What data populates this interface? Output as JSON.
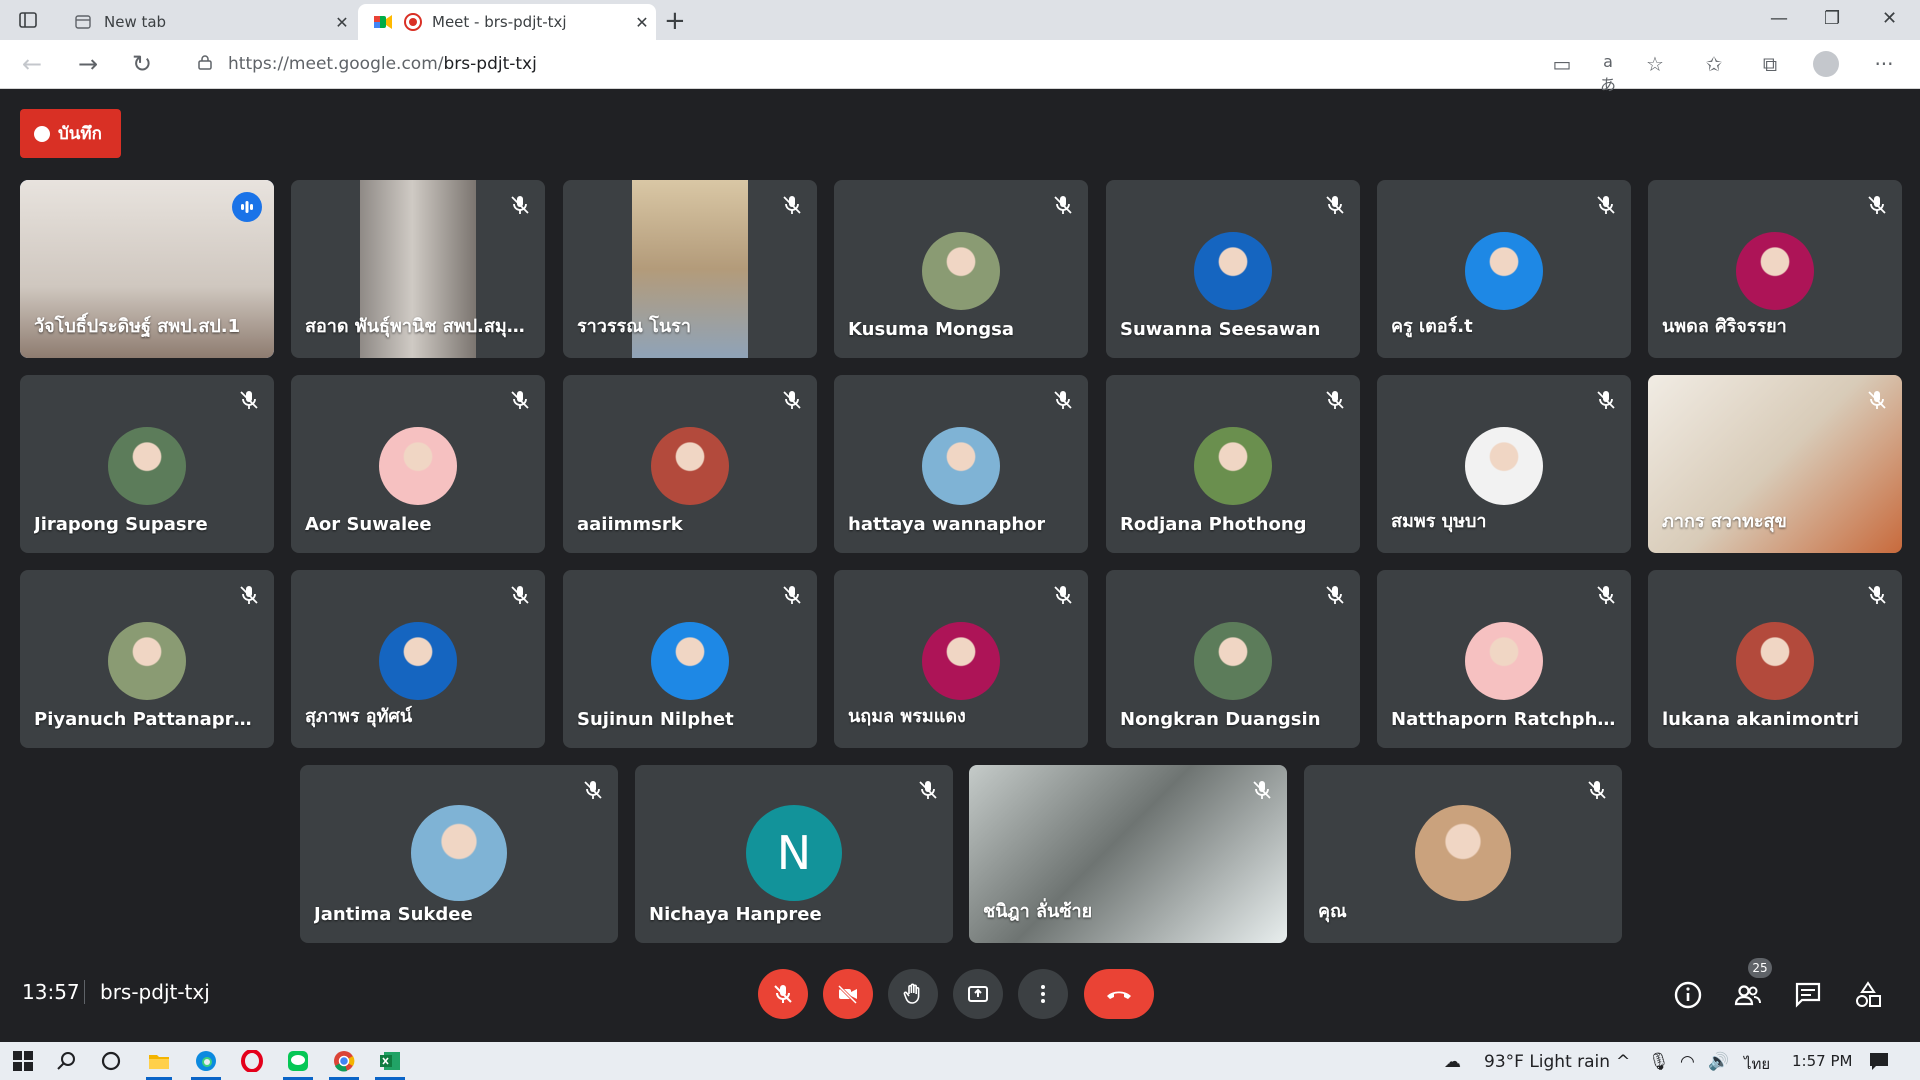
{
  "browser": {
    "tabs": [
      {
        "title": "New tab",
        "active": false
      },
      {
        "title": "Meet - brs-pdjt-txj",
        "active": true
      }
    ],
    "url_host": "https://meet.google.com/",
    "url_path": "brs-pdjt-txj"
  },
  "meet": {
    "record_label": "บันทึก",
    "time": "13:57",
    "meeting_code": "brs-pdjt-txj",
    "participant_count": "25",
    "accent": "#8ab4f8",
    "danger": "#ea4335"
  },
  "participants": [
    {
      "name": "วัจโบธิ์ประดิษฐ์ สพป.สป.1",
      "kind": "video",
      "speaking": true
    },
    {
      "name": "สอาด พันธุ์พานิช สพป.สมุท...",
      "kind": "video"
    },
    {
      "name": "ราวรรณ โนรา",
      "kind": "video"
    },
    {
      "name": "Kusuma Mongsa",
      "kind": "avatar"
    },
    {
      "name": "Suwanna Seesawan",
      "kind": "avatar"
    },
    {
      "name": "ครู เตอร์.t",
      "kind": "avatar"
    },
    {
      "name": "นพดล ศิริจรรยา",
      "kind": "avatar"
    },
    {
      "name": "Jirapong Supasre",
      "kind": "avatar"
    },
    {
      "name": "Aor Suwalee",
      "kind": "avatar"
    },
    {
      "name": "aaiimmsrk",
      "kind": "avatar"
    },
    {
      "name": "hattaya wannaphor",
      "kind": "avatar"
    },
    {
      "name": "Rodjana Phothong",
      "kind": "avatar"
    },
    {
      "name": "สมพร บุษบา",
      "kind": "avatar"
    },
    {
      "name": "ภากร สวาทะสุข",
      "kind": "video"
    },
    {
      "name": "Piyanuch Pattanaprasert",
      "kind": "avatar"
    },
    {
      "name": "สุภาพร อุทัศน์",
      "kind": "avatar"
    },
    {
      "name": "Sujinun Nilphet",
      "kind": "avatar"
    },
    {
      "name": "นฤมล พรมแดง",
      "kind": "avatar"
    },
    {
      "name": "Nongkran Duangsin",
      "kind": "avatar"
    },
    {
      "name": "Natthaporn Ratchphumi",
      "kind": "avatar"
    },
    {
      "name": "lukana akanimontri",
      "kind": "avatar"
    },
    {
      "name": "Jantima Sukdee",
      "kind": "avatar"
    },
    {
      "name": "Nichaya Hanpree",
      "kind": "initial",
      "initial": "N"
    },
    {
      "name": "ชนิฎา ลั่นซ้าย",
      "kind": "video"
    },
    {
      "name": "คุณ",
      "kind": "avatar"
    }
  ],
  "taskbar": {
    "weather": "93°F  Light rain",
    "lang": "ไทย",
    "clock": "1:57 PM"
  }
}
